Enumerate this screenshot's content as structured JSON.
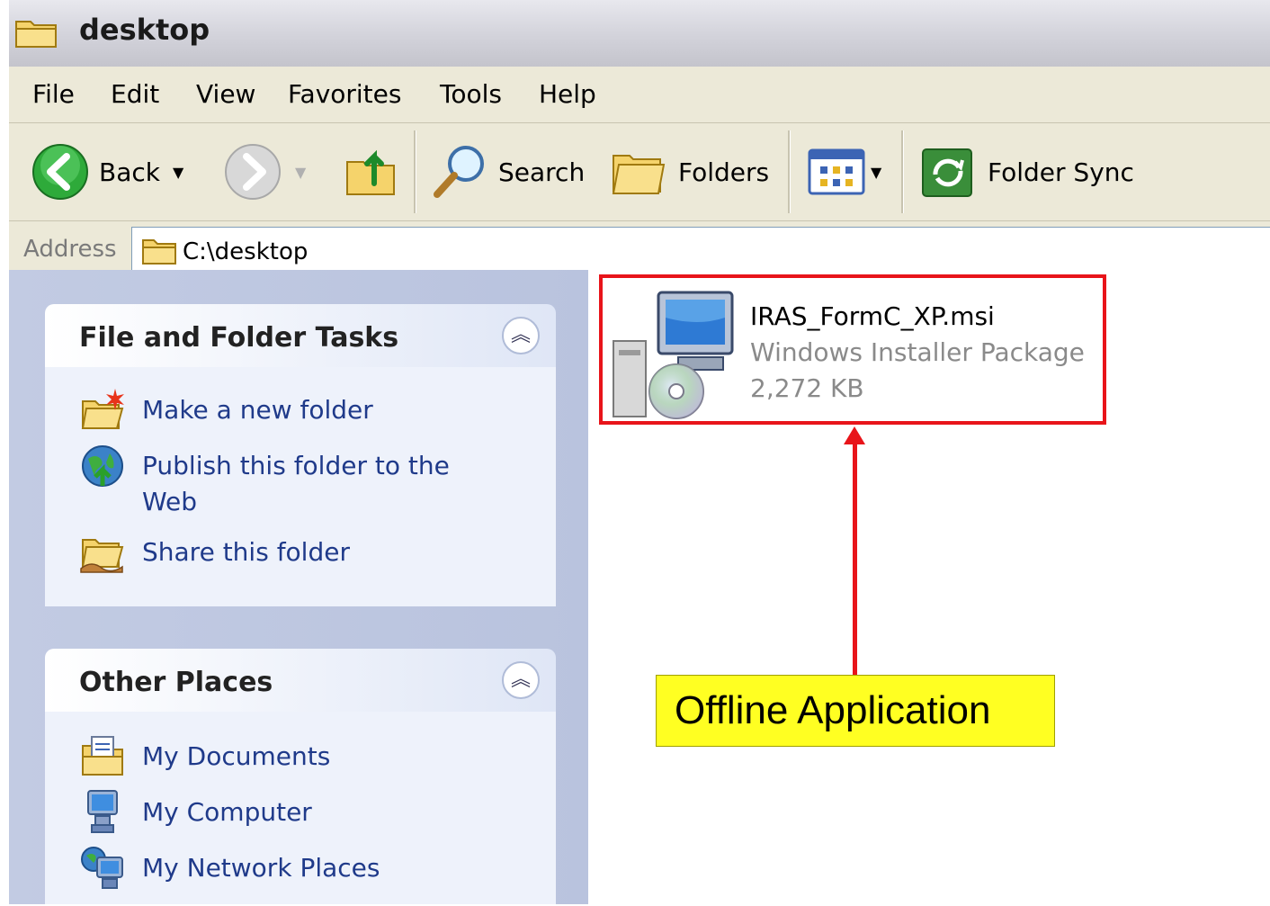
{
  "window": {
    "title": "desktop"
  },
  "menu": [
    "File",
    "Edit",
    "View",
    "Favorites",
    "Tools",
    "Help"
  ],
  "toolbar": {
    "back_label": "Back",
    "search_label": "Search",
    "folders_label": "Folders",
    "foldersync_label": "Folder Sync"
  },
  "address": {
    "label": "Address",
    "path": "C:\\desktop"
  },
  "tasks_panel": {
    "title": "File and Folder Tasks",
    "items": [
      {
        "label": "Make a new folder",
        "icon": "new-folder-icon"
      },
      {
        "label": "Publish this folder to the Web",
        "icon": "publish-web-icon"
      },
      {
        "label": "Share this folder",
        "icon": "share-folder-icon"
      }
    ]
  },
  "places_panel": {
    "title": "Other Places",
    "items": [
      {
        "label": "My Documents",
        "icon": "my-documents-icon"
      },
      {
        "label": "My Computer",
        "icon": "my-computer-icon"
      },
      {
        "label": "My Network Places",
        "icon": "network-places-icon"
      }
    ]
  },
  "file": {
    "name": "IRAS_FormC_XP.msi",
    "type": "Windows Installer Package",
    "size": "2,272 KB",
    "icon": "installer-package-icon"
  },
  "annotation": {
    "label": "Offline Application",
    "highlight_color": "#e8141a",
    "callout_color": "#ffff22"
  }
}
